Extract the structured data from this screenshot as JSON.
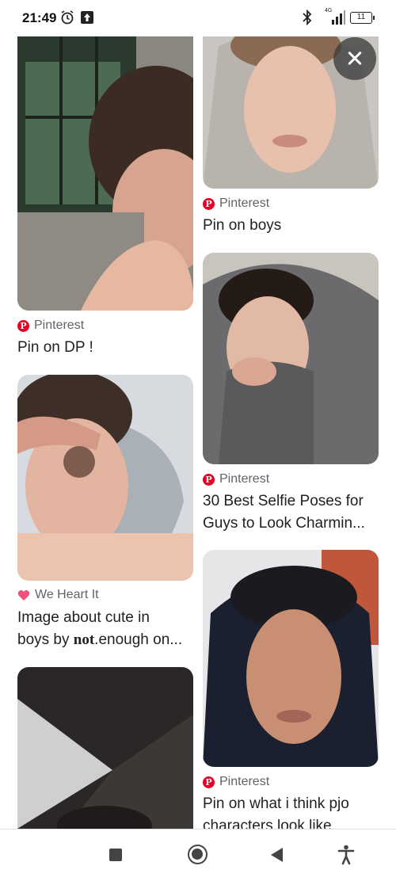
{
  "status_bar": {
    "time": "21:49",
    "network_type": "4G",
    "battery_level": "11",
    "icons": [
      "alarm-icon",
      "upload-icon",
      "bluetooth-icon",
      "signal-icon",
      "battery-icon"
    ]
  },
  "close_button": {
    "icon": "close-icon"
  },
  "cards": [
    {
      "source": "Pinterest",
      "title": "Pin on DP !",
      "source_icon": "pinterest-icon"
    },
    {
      "source": "We Heart It",
      "title_line1": "Image about cute in",
      "title_line2_prefix": "boys by ",
      "title_line2_bold": "not",
      "title_line2_suffix": ".enough on...",
      "source_icon": "heart-icon"
    },
    {
      "source": "Pinterest",
      "title": "Pin on boys",
      "source_icon": "pinterest-icon"
    },
    {
      "source": "Pinterest",
      "title_line1": "30 Best Selfie Poses for",
      "title_line2": "Guys to Look Charmin...",
      "source_icon": "pinterest-icon"
    },
    {
      "source": "Pinterest",
      "title_line1": "Pin on what i think pjo",
      "title_line2": "characters look like",
      "source_icon": "pinterest-icon"
    }
  ],
  "colors": {
    "pinterest_red": "#e60023",
    "heart_pink": "#f0517a",
    "text_primary": "#202124",
    "text_secondary": "#5f6368"
  },
  "nav_bar": {
    "icons": [
      "recents-icon",
      "home-icon",
      "back-icon",
      "accessibility-icon"
    ]
  }
}
